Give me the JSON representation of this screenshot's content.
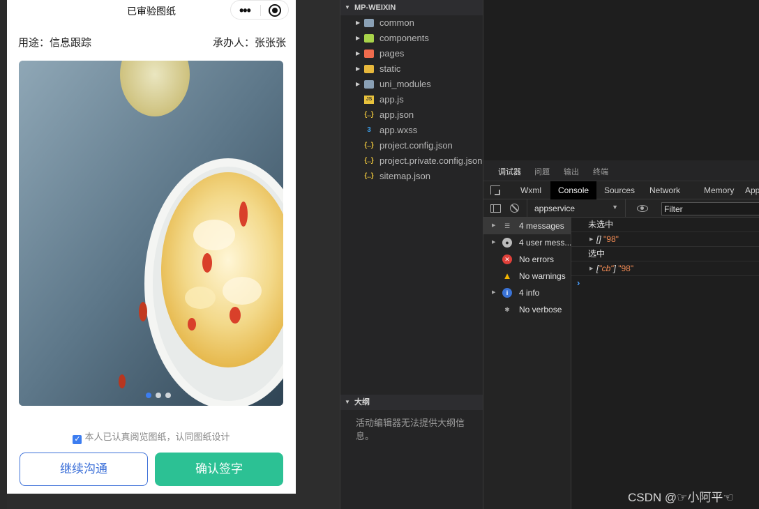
{
  "simulator": {
    "nav_title": "已审验图纸",
    "purpose_label": "用途：信息跟踪",
    "assignee_label": "承办人：张张张",
    "swiper_dot_count": 3,
    "swiper_active_dot": 0,
    "agreement_text": "本人已认真阅览图纸，认同图纸设计",
    "agreement_checked": true,
    "continue_button": "继续沟通",
    "confirm_button": "确认签字",
    "colors": {
      "primary": "#3b6fd8",
      "confirm": "#2cc194",
      "checkbox": "#3c7df0"
    }
  },
  "explorer": {
    "root_label": "MP-WEIXIN",
    "items": [
      {
        "label": "common",
        "type": "folder",
        "icon": "folder-icon",
        "color": "#8aa0b5"
      },
      {
        "label": "components",
        "type": "folder",
        "icon": "components-folder-icon",
        "color": "#a8d34a"
      },
      {
        "label": "pages",
        "type": "folder",
        "icon": "pages-folder-icon",
        "color": "#f06b4d"
      },
      {
        "label": "static",
        "type": "folder",
        "icon": "static-folder-icon",
        "color": "#e8b83c"
      },
      {
        "label": "uni_modules",
        "type": "folder",
        "icon": "folder-icon",
        "color": "#8aa0b5"
      },
      {
        "label": "app.js",
        "type": "file",
        "icon": "js-file-icon",
        "glyph": "JS",
        "color": "#e8c23c"
      },
      {
        "label": "app.json",
        "type": "file",
        "icon": "json-file-icon",
        "glyph": "{..}",
        "color": "#e8c23c"
      },
      {
        "label": "app.wxss",
        "type": "file",
        "icon": "css-file-icon",
        "glyph": "3",
        "color": "#3c9ee8"
      },
      {
        "label": "project.config.json",
        "type": "file",
        "icon": "json-file-icon",
        "glyph": "{..}",
        "color": "#e8c23c"
      },
      {
        "label": "project.private.config.json",
        "type": "file",
        "icon": "json-file-icon",
        "glyph": "{..}",
        "color": "#e8c23c"
      },
      {
        "label": "sitemap.json",
        "type": "file",
        "icon": "json-file-icon",
        "glyph": "{..}",
        "color": "#e8c23c"
      }
    ],
    "outline_label": "大纲",
    "outline_message": "活动编辑器无法提供大纲信息。"
  },
  "devtools": {
    "top_tabs": [
      "调试器",
      "问题",
      "输出",
      "终端"
    ],
    "panel_tabs": [
      "Wxml",
      "Console",
      "Sources",
      "Network",
      "Memory",
      "App"
    ],
    "active_panel": "Console",
    "context": "appservice",
    "filter_placeholder": "Filter",
    "sidebar": [
      {
        "label": "4 messages",
        "icon": "list-icon",
        "expandable": true,
        "selected": true
      },
      {
        "label": "4 user mess...",
        "icon": "user-icon",
        "expandable": true,
        "selected": false
      },
      {
        "label": "No errors",
        "icon": "error-icon",
        "expandable": false,
        "selected": false
      },
      {
        "label": "No warnings",
        "icon": "warning-icon",
        "expandable": false,
        "selected": false
      },
      {
        "label": "4 info",
        "icon": "info-icon",
        "expandable": true,
        "selected": false
      },
      {
        "label": "No verbose",
        "icon": "bug-icon",
        "expandable": false,
        "selected": false
      }
    ],
    "logs": {
      "line1": "未选中",
      "line2_bracket": "[]",
      "line2_value": "\"98\"",
      "line3": "选中",
      "line4_open": "[",
      "line4_item": "\"cb\"",
      "line4_close": "]",
      "line4_value": "\"98\""
    },
    "prompt": "›"
  },
  "watermark": "CSDN @☞小阿平☜"
}
